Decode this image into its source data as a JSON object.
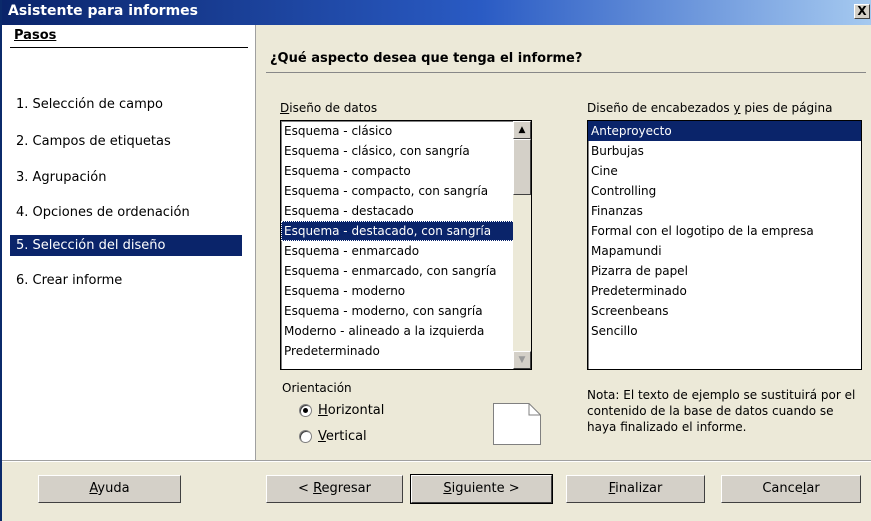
{
  "window": {
    "title": "Asistente para informes",
    "close_glyph": "X"
  },
  "steps": {
    "heading": "Pasos",
    "items": [
      {
        "label": "1. Selección de campo"
      },
      {
        "label": "2. Campos de etiquetas"
      },
      {
        "label": "3. Agrupación"
      },
      {
        "label": "4. Opciones de ordenación"
      },
      {
        "label": "5. Selección del diseño"
      },
      {
        "label": "6. Crear informe"
      }
    ],
    "selected_index": 4
  },
  "main": {
    "heading": "¿Qué aspecto desea que tenga el informe?",
    "data_layout": {
      "label_pre": "",
      "label_hot": "D",
      "label_post": "iseño de datos",
      "items": [
        "Esquema - clásico",
        "Esquema - clásico, con sangría",
        "Esquema - compacto",
        "Esquema - compacto, con sangría",
        "Esquema - destacado",
        "Esquema - destacado, con sangría",
        "Esquema - enmarcado",
        "Esquema - enmarcado, con sangría",
        "Esquema - moderno",
        "Esquema - moderno, con sangría",
        "Moderno - alineado a la izquierda",
        "Predeterminado"
      ],
      "selected": "Esquema - destacado, con sangría"
    },
    "header_layout": {
      "label_pre": "Diseño de encabezados ",
      "label_hot": "y",
      "label_post": " pies de página",
      "items": [
        "Anteproyecto",
        "Burbujas",
        "Cine",
        "Controlling",
        "Finanzas",
        "Formal con el logotipo de la empresa",
        "Mapamundi",
        "Pizarra de papel",
        "Predeterminado",
        "Screenbeans",
        "Sencillo"
      ],
      "selected": "Anteproyecto"
    },
    "orientation": {
      "label": "Orientación",
      "horizontal": {
        "hot": "H",
        "rest": "orizontal",
        "checked": true
      },
      "vertical": {
        "hot": "V",
        "rest": "ertical",
        "checked": false
      }
    },
    "note": "Nota: El texto de ejemplo se sustituirá por el contenido de la base de datos cuando se haya finalizado el informe."
  },
  "buttons": {
    "help": {
      "hot": "A",
      "rest": "yuda"
    },
    "back": {
      "pre": "< ",
      "hot": "R",
      "rest": "egresar"
    },
    "next": {
      "hot": "S",
      "rest": "iguiente >"
    },
    "finish": {
      "hot": "F",
      "rest": "inalizar"
    },
    "cancel": {
      "pre": "Cance",
      "hot": "l",
      "rest": "ar"
    }
  },
  "icons": {
    "close": "close-icon",
    "up": "scroll-up-arrow-icon",
    "down": "scroll-down-arrow-icon",
    "page": "page-preview-icon"
  }
}
